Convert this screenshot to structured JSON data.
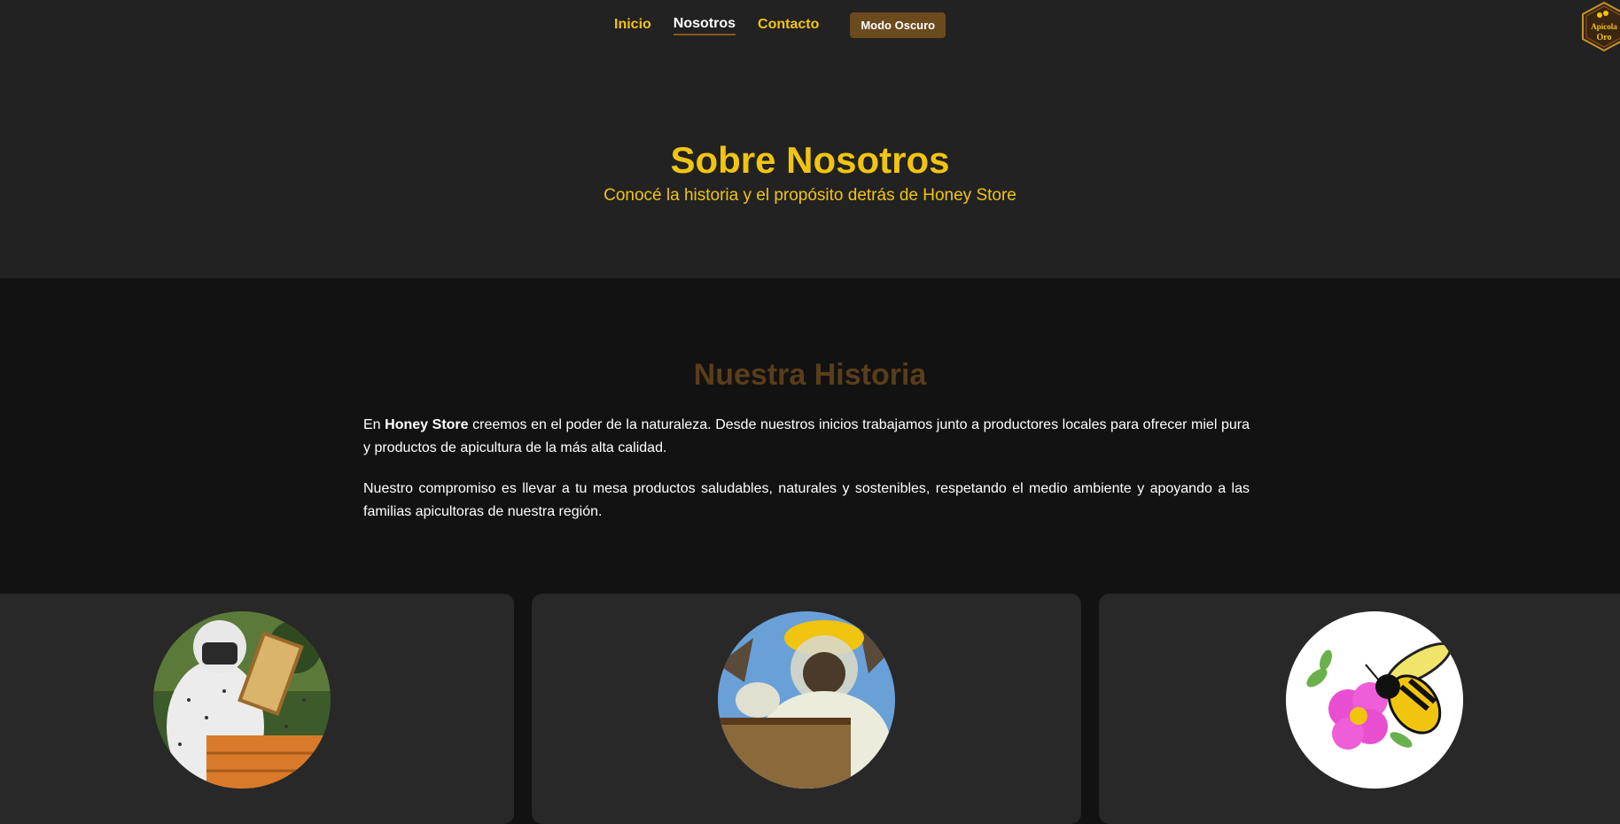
{
  "nav": {
    "items": [
      {
        "label": "Inicio"
      },
      {
        "label": "Nosotros"
      },
      {
        "label": "Contacto"
      }
    ],
    "mode_button": "Modo Oscuro"
  },
  "logo": {
    "line1": "Apícola",
    "line2": "Oro"
  },
  "hero": {
    "title": "Sobre Nosotros",
    "subtitle": "Conocé la historia y el propósito detrás de Honey Store"
  },
  "history": {
    "title": "Nuestra Historia",
    "p1_prefix": "En ",
    "p1_brand": "Honey Store",
    "p1_rest": " creemos en el poder de la naturaleza. Desde nuestros inicios trabajamos junto a productores locales para ofrecer miel pura y productos de apicultura de la más alta calidad.",
    "p2": "Nuestro compromiso es llevar a tu mesa productos saludables, naturales y sostenibles, respetando el medio ambiente y apoyando a las familias apicultoras de nuestra región."
  },
  "colors": {
    "accent": "#f1c40f",
    "brown": "#6b4a1e",
    "history_title": "#5a3d1a",
    "bg_dark": "#121212",
    "bg_panel": "#222222",
    "card": "#282828"
  },
  "cards": [
    {
      "image": "beekeeper-frame-photo"
    },
    {
      "image": "beekeeper-hive-photo"
    },
    {
      "image": "bee-flower-illustration"
    }
  ]
}
